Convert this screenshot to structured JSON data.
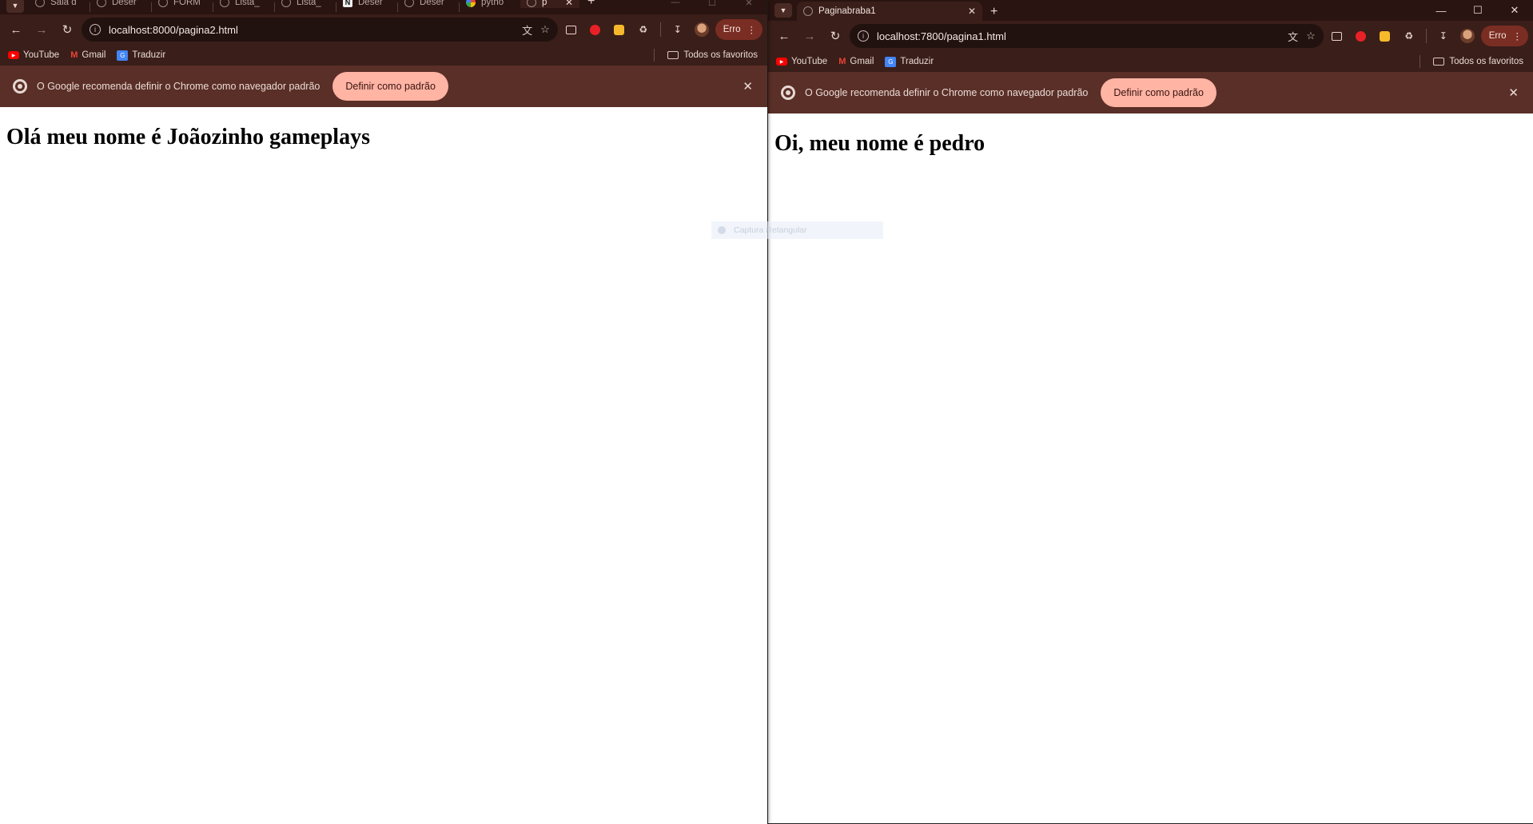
{
  "left_window": {
    "tabs": [
      {
        "title": "Sala d",
        "favicon": "classroom-icon"
      },
      {
        "title": "Deser",
        "favicon": "globe-icon"
      },
      {
        "title": "FORM",
        "favicon": "globe-icon"
      },
      {
        "title": "Lista_",
        "favicon": "globe-icon"
      },
      {
        "title": "Lista_",
        "favicon": "globe-icon"
      },
      {
        "title": "Deser",
        "favicon": "notion-icon"
      },
      {
        "title": "Deser",
        "favicon": "globe-icon"
      },
      {
        "title": "pytho",
        "favicon": "google-icon"
      },
      {
        "title": "p",
        "favicon": "globe-icon"
      }
    ],
    "url": "localhost:8000/pagina2.html",
    "heading": "Olá meu nome é Joãozinho gameplays"
  },
  "right_window": {
    "tab_title": "Paginabraba1",
    "url": "localhost:7800/pagina1.html",
    "heading": "Oi, meu nome é pedro"
  },
  "toolbar": {
    "profile_label": "Erro"
  },
  "bookmarks": {
    "youtube": "YouTube",
    "gmail": "Gmail",
    "traduzir": "Traduzir",
    "all": "Todos os favoritos"
  },
  "infobar": {
    "message": "O Google recomenda definir o Chrome como navegador padrão",
    "button": "Definir como padrão"
  },
  "overlay": {
    "capture_label": "Captura Retangular"
  },
  "colors": {
    "frame": "#3a1e19",
    "infobar": "#5a2f27",
    "infobar_button": "#ffb4a4",
    "profile_button": "#7a2d22"
  }
}
